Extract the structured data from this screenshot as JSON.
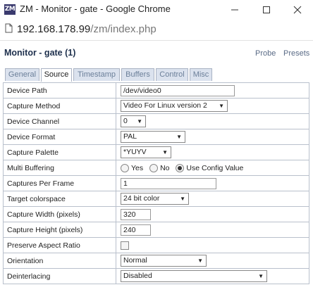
{
  "window": {
    "logo": "ZM",
    "title": "ZM - Monitor - gate - Google Chrome"
  },
  "address": {
    "host": "192.168.178.99",
    "path": "/zm/index.php"
  },
  "page": {
    "title": "Monitor - gate (1)",
    "links": {
      "probe": "Probe",
      "presets": "Presets"
    },
    "tabs": [
      "General",
      "Source",
      "Timestamp",
      "Buffers",
      "Control",
      "Misc"
    ],
    "active_tab": "Source"
  },
  "form": {
    "device_path": {
      "label": "Device Path",
      "value": "/dev/video0"
    },
    "capture_method": {
      "label": "Capture Method",
      "value": "Video For Linux version 2"
    },
    "device_channel": {
      "label": "Device Channel",
      "value": "0"
    },
    "device_format": {
      "label": "Device Format",
      "value": "PAL"
    },
    "capture_palette": {
      "label": "Capture Palette",
      "value": "*YUYV"
    },
    "multi_buffering": {
      "label": "Multi Buffering",
      "options": [
        "Yes",
        "No",
        "Use Config Value"
      ],
      "selected": "Use Config Value"
    },
    "captures_per_frame": {
      "label": "Captures Per Frame",
      "value": "1"
    },
    "target_colorspace": {
      "label": "Target colorspace",
      "value": "24 bit color"
    },
    "capture_width": {
      "label": "Capture Width (pixels)",
      "value": "320"
    },
    "capture_height": {
      "label": "Capture Height (pixels)",
      "value": "240"
    },
    "preserve_aspect": {
      "label": "Preserve Aspect Ratio",
      "checked": false
    },
    "orientation": {
      "label": "Orientation",
      "value": "Normal"
    },
    "deinterlacing": {
      "label": "Deinterlacing",
      "value": "Disabled"
    }
  },
  "colors": {
    "title": "#1d2f4c",
    "tab_bg": "#dbe2ee",
    "border": "#b9c0cc"
  },
  "icons": [
    "zm-logo-icon",
    "minimize-icon",
    "maximize-icon",
    "close-icon",
    "document-icon",
    "dropdown-caret-icon"
  ]
}
